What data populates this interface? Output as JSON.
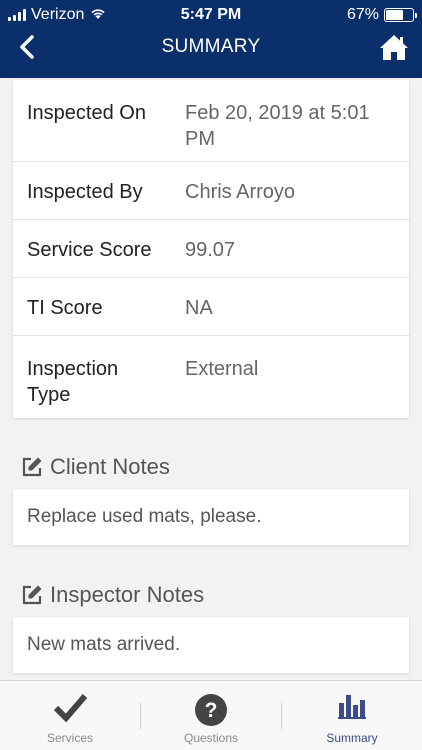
{
  "status_bar": {
    "carrier": "Verizon",
    "time": "5:47 PM",
    "battery": "67%",
    "battery_level": 0.67
  },
  "nav": {
    "title": "SUMMARY",
    "back_icon": "chevron-left-icon",
    "home_icon": "home-icon"
  },
  "details": [
    {
      "label": "Inspected On",
      "value": "Feb 20, 2019 at 5:01 PM"
    },
    {
      "label": "Inspected By",
      "value": "Chris Arroyo"
    },
    {
      "label": "Service Score",
      "value": "99.07"
    },
    {
      "label": "TI Score",
      "value": "NA"
    },
    {
      "label": "Inspection Type",
      "value": "External"
    }
  ],
  "client_notes": {
    "title": "Client Notes",
    "text": "Replace used mats, please."
  },
  "inspector_notes": {
    "title": "Inspector Notes",
    "text": "New mats arrived."
  },
  "tabs": [
    {
      "label": "Services",
      "icon": "checkmark-icon"
    },
    {
      "label": "Questions",
      "icon": "question-circle-icon"
    },
    {
      "label": "Summary",
      "icon": "bar-chart-icon",
      "active": true
    }
  ],
  "colors": {
    "header": "#0b2f6b",
    "active_tab": "#3b4c8a"
  }
}
